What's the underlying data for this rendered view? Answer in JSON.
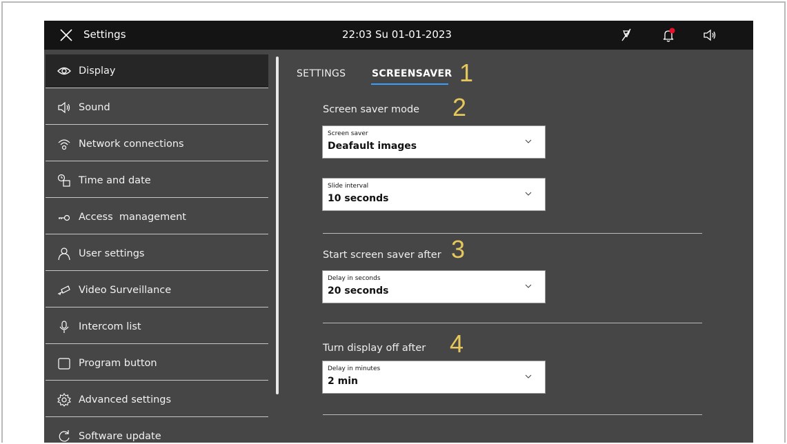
{
  "topbar": {
    "title": "Settings",
    "datetime": "22:03  Su 01-01-2023",
    "icons": [
      "close-icon",
      "mic-muted-icon",
      "notification-bell-icon",
      "speaker-icon"
    ],
    "notification_dot_color": "#e8112d"
  },
  "sidebar": {
    "items": [
      {
        "label": "Display",
        "icon": "eye-icon",
        "active": true
      },
      {
        "label": "Sound",
        "icon": "speaker-icon"
      },
      {
        "label": "Network connections",
        "icon": "wifi-icon"
      },
      {
        "label": "Time and date",
        "icon": "clock-calendar-icon"
      },
      {
        "label": "Access  management",
        "icon": "key-icon"
      },
      {
        "label": "User settings",
        "icon": "user-icon"
      },
      {
        "label": "Video Surveillance",
        "icon": "camera-icon"
      },
      {
        "label": "Intercom list",
        "icon": "microphone-icon"
      },
      {
        "label": "Program button",
        "icon": "square-button-icon"
      },
      {
        "label": "Advanced settings",
        "icon": "gear-icon"
      },
      {
        "label": "Software update",
        "icon": "refresh-icon"
      }
    ]
  },
  "tabs": [
    {
      "label": "SETTINGS",
      "active": false
    },
    {
      "label": "SCREENSAVER",
      "active": true
    }
  ],
  "tab_accent_color": "#3aa0ff",
  "callouts": [
    "1",
    "2",
    "3",
    "4"
  ],
  "callout_color": "#e6c75c",
  "sections": {
    "mode": {
      "title": "Screen saver mode",
      "screen_saver": {
        "label": "Screen saver",
        "value": "Deafault images"
      },
      "slide_interval": {
        "label": "Slide interval",
        "value": "10 seconds"
      }
    },
    "start": {
      "title": "Start screen saver after",
      "delay": {
        "label": "Delay in seconds",
        "value": "20 seconds"
      }
    },
    "display_off": {
      "title": "Turn display off after",
      "delay": {
        "label": "Delay in minutes",
        "value": "2 min"
      }
    }
  }
}
